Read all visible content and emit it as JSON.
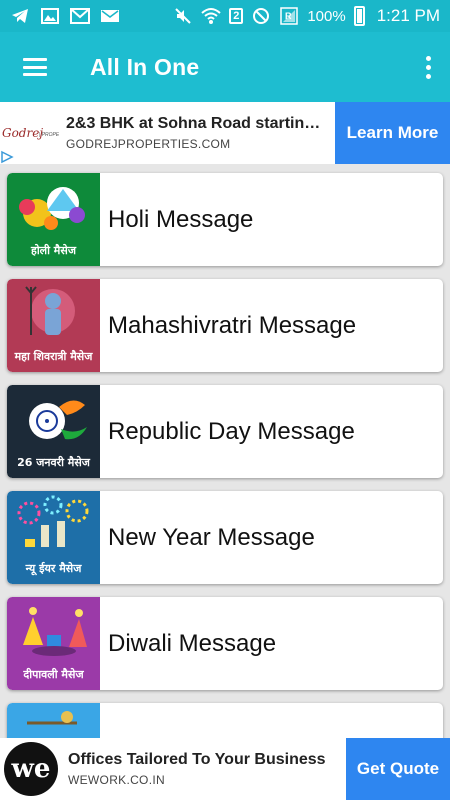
{
  "status_bar": {
    "sim_badge": "2",
    "battery": "100%",
    "time": "1:21 PM",
    "icons": [
      "telegram-icon",
      "gallery-icon",
      "gmail-icon",
      "mail-icon",
      "mute-icon",
      "wifi-icon",
      "sim-icon",
      "blocked-icon",
      "signal-icon",
      "battery-icon"
    ]
  },
  "app_bar": {
    "title": "All In One",
    "background": "#1ebdd0"
  },
  "ad_top": {
    "brand_logo_text": "Godrej | PROPERTIES",
    "headline": "2&3 BHK at Sohna Road starting at",
    "domain": "GODREJPROPERTIES.COM",
    "cta": "Learn More",
    "cta_color": "#2e86f0"
  },
  "list": {
    "items": [
      {
        "label": "Holi Message",
        "caption": "होली मैसेज",
        "color": "#0e8a3a"
      },
      {
        "label": "Mahashivratri Message",
        "caption": "महा शिवरात्री मैसेज",
        "color": "#b23a55"
      },
      {
        "label": "Republic Day Message",
        "caption": "26 जनवरी मैसेज",
        "color": "#1c2a38"
      },
      {
        "label": "New Year Message",
        "caption": "न्यू ईयर मैसेज",
        "color": "#1e6fa8"
      },
      {
        "label": "Diwali Message",
        "caption": "दीपावली मैसेज",
        "color": "#9b3aa8"
      },
      {
        "label": "",
        "caption": "",
        "color": "#3aa6e6"
      }
    ]
  },
  "ad_bottom": {
    "logo_text": "we",
    "headline": "Offices Tailored To Your Business",
    "domain": "WEWORK.CO.IN",
    "cta": "Get Quote",
    "cta_color": "#2e86f0"
  }
}
